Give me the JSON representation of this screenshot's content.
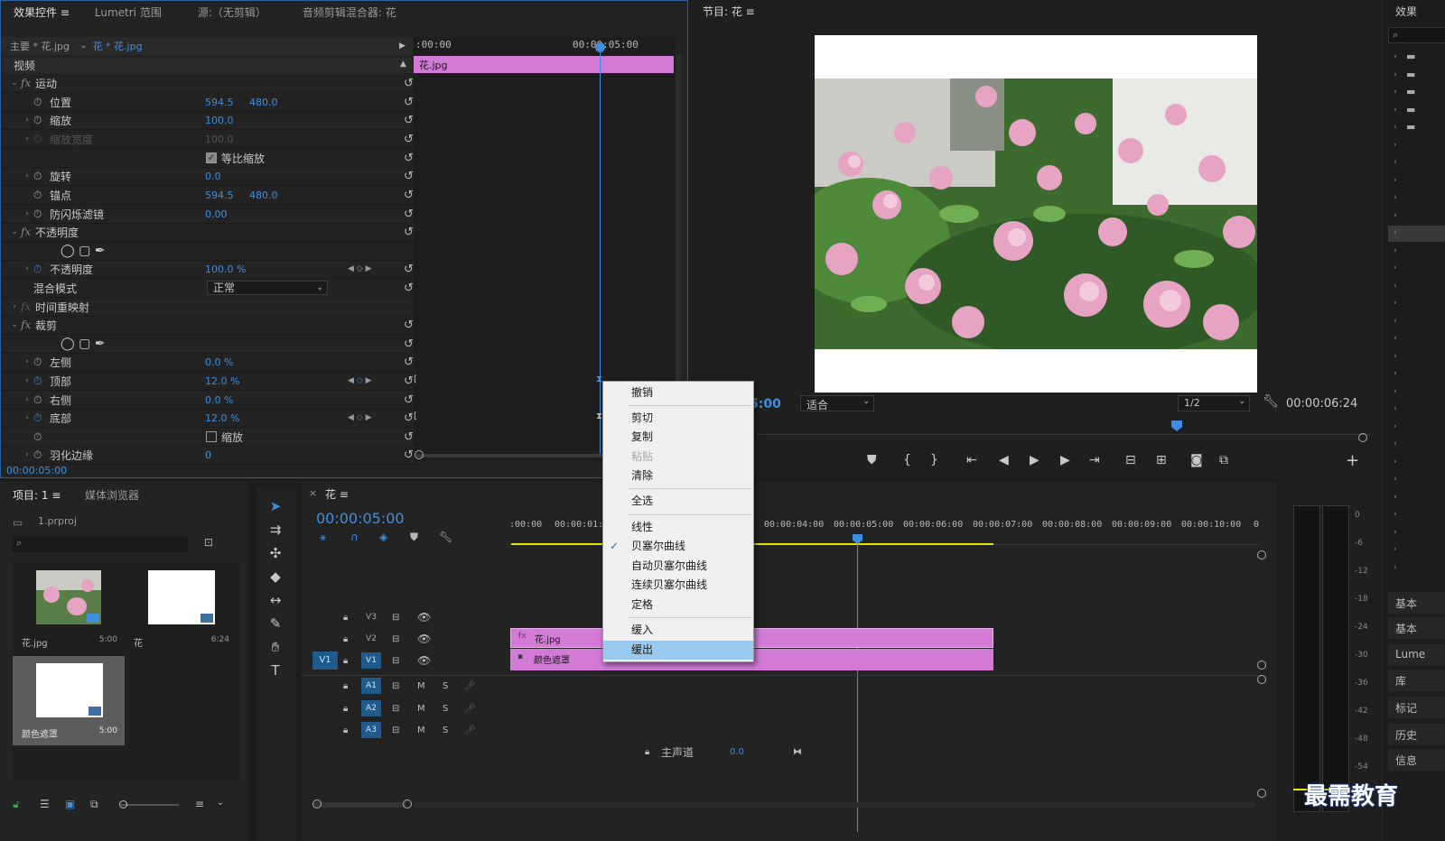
{
  "colors": {
    "accent": "#3e8fe0",
    "clip_pink": "#d27ad6",
    "playhead": "#3e8fe0",
    "menu_bg": "#f0f0f0",
    "menu_highlight": "#99c9ef",
    "work_area": "#e5e500"
  },
  "effects_panel": {
    "tabs": [
      "效果控件",
      "Lumetri 范围",
      "源:（无剪辑）",
      "音频剪辑混合器: 花"
    ],
    "master_label": "主要 * 花.jpg",
    "clip_label": "花 * 花.jpg",
    "timecode_start": ":00:00",
    "timecode_mid": "00:00:05:00",
    "clip_name": "花.jpg",
    "section_video": "视频",
    "rows": [
      {
        "label": "运动",
        "type": "fx"
      },
      {
        "label": "位置",
        "v1": "594.5",
        "v2": "480.0"
      },
      {
        "label": "缩放",
        "v1": "100.0"
      },
      {
        "label": "缩放宽度",
        "v1": "100.0",
        "disabled": true
      },
      {
        "label": "等比缩放",
        "type": "checkbox"
      },
      {
        "label": "旋转",
        "v1": "0.0"
      },
      {
        "label": "锚点",
        "v1": "594.5",
        "v2": "480.0"
      },
      {
        "label": "防闪烁滤镜",
        "v1": "0.00"
      },
      {
        "label": "不透明度",
        "type": "fx"
      },
      {
        "label": "",
        "type": "shapes"
      },
      {
        "label": "不透明度",
        "v1": "100.0 %"
      },
      {
        "label": "混合模式",
        "select": "正常"
      },
      {
        "label": "时间重映射",
        "type": "fx"
      },
      {
        "label": "裁剪",
        "type": "fx"
      },
      {
        "label": "",
        "type": "shapes"
      },
      {
        "label": "左侧",
        "v1": "0.0 %"
      },
      {
        "label": "顶部",
        "v1": "12.0 %"
      },
      {
        "label": "右侧",
        "v1": "0.0 %"
      },
      {
        "label": "底部",
        "v1": "12.0 %"
      },
      {
        "label": "缩放",
        "type": "checkbox"
      },
      {
        "label": "羽化边缘",
        "v1": "0"
      }
    ],
    "current_time": "00:00:05:00"
  },
  "program_monitor": {
    "title": "节目: 花",
    "fit": "适合",
    "resolution": "1/2",
    "timecode_left": "5:00",
    "duration": "00:00:06:24"
  },
  "project_panel": {
    "tabs": [
      "项目: 1",
      "媒体浏览器"
    ],
    "project_file": "1.prproj",
    "items": [
      {
        "name": "花.jpg",
        "duration": "5:00"
      },
      {
        "name": "花",
        "duration": "6:24"
      },
      {
        "name": "颜色遮罩",
        "duration": "5:00"
      }
    ]
  },
  "timeline": {
    "title": "花",
    "timecode": "00:00:05:00",
    "ruler": [
      ":00:00",
      "00:00:01:0",
      "00:00:04:00",
      "00:00:05:00",
      "00:00:06:00",
      "00:00:07:00",
      "00:00:08:00",
      "00:00:09:00",
      "00:00:10:00",
      "0"
    ],
    "tracks": [
      {
        "name": "V3"
      },
      {
        "name": "V2"
      },
      {
        "name": "V1",
        "source": "V1"
      },
      {
        "name": "A1",
        "m": "M",
        "s": "S"
      },
      {
        "name": "A2",
        "m": "M",
        "s": "S"
      },
      {
        "name": "A3",
        "m": "M",
        "s": "S"
      }
    ],
    "master_label": "主声道",
    "master_value": "0.0",
    "clips": [
      {
        "name": "花.jpg",
        "track": "V2"
      },
      {
        "name": "颜色遮罩",
        "track": "V1"
      }
    ]
  },
  "context_menu": {
    "items": [
      "撤销",
      "剪切",
      "复制",
      "粘贴",
      "清除",
      "全选",
      "线性",
      "贝塞尔曲线",
      "自动贝塞尔曲线",
      "连续贝塞尔曲线",
      "定格",
      "缓入",
      "缓出"
    ],
    "checked": "贝塞尔曲线",
    "disabled": "粘贴",
    "highlighted": "缓出"
  },
  "meters": {
    "scale": [
      "0",
      "-6",
      "-12",
      "-18",
      "-24",
      "-30",
      "-36",
      "-42",
      "-48",
      "-54"
    ]
  },
  "right_panel": {
    "title": "效果",
    "items": [
      "基本",
      "基本",
      "Lume",
      "库",
      "标记",
      "历史",
      "信息"
    ]
  },
  "watermark": "最需教育"
}
